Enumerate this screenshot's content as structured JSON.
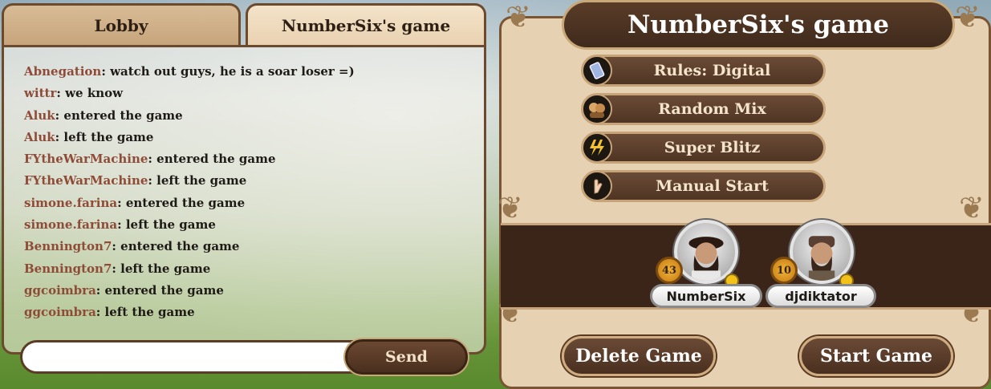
{
  "tabs": [
    {
      "label": "Lobby",
      "active": false
    },
    {
      "label": "NumberSix's game",
      "active": true
    }
  ],
  "chat": {
    "messages": [
      {
        "user": "Abnegation",
        "text": ": watch out guys, he is a soar loser =)"
      },
      {
        "user": "wittr",
        "text": ": we know"
      },
      {
        "user": "Aluk",
        "text": ": entered the game"
      },
      {
        "user": "Aluk",
        "text": ": left the game"
      },
      {
        "user": "FYtheWarMachine",
        "text": ": entered the game"
      },
      {
        "user": "FYtheWarMachine",
        "text": ": left the game"
      },
      {
        "user": "simone.farina",
        "text": ": entered the game"
      },
      {
        "user": "simone.farina",
        "text": ": left the game"
      },
      {
        "user": "Bennington7",
        "text": ": entered the game"
      },
      {
        "user": "Bennington7",
        "text": ": left the game"
      },
      {
        "user": "ggcoimbra",
        "text": ": entered the game"
      },
      {
        "user": "ggcoimbra",
        "text": ": left the game"
      }
    ],
    "input_value": "",
    "send_label": "Send"
  },
  "game": {
    "title": "NumberSix's game",
    "options": [
      {
        "label": "Rules: Digital",
        "icon": "tablet-icon"
      },
      {
        "label": "Random Mix",
        "icon": "heroes-portrait-icon"
      },
      {
        "label": "Super Blitz",
        "icon": "lightning-icon"
      },
      {
        "label": "Manual Start",
        "icon": "hand-icon"
      }
    ],
    "players": [
      {
        "name": "NumberSix",
        "level": "43"
      },
      {
        "name": "djdiktator",
        "level": "10"
      }
    ],
    "delete_label": "Delete Game",
    "start_label": "Start Game"
  },
  "colors": {
    "user_name": "#8e4b37",
    "button_brown": "#503524",
    "panel_beige": "#e6d2b3"
  }
}
